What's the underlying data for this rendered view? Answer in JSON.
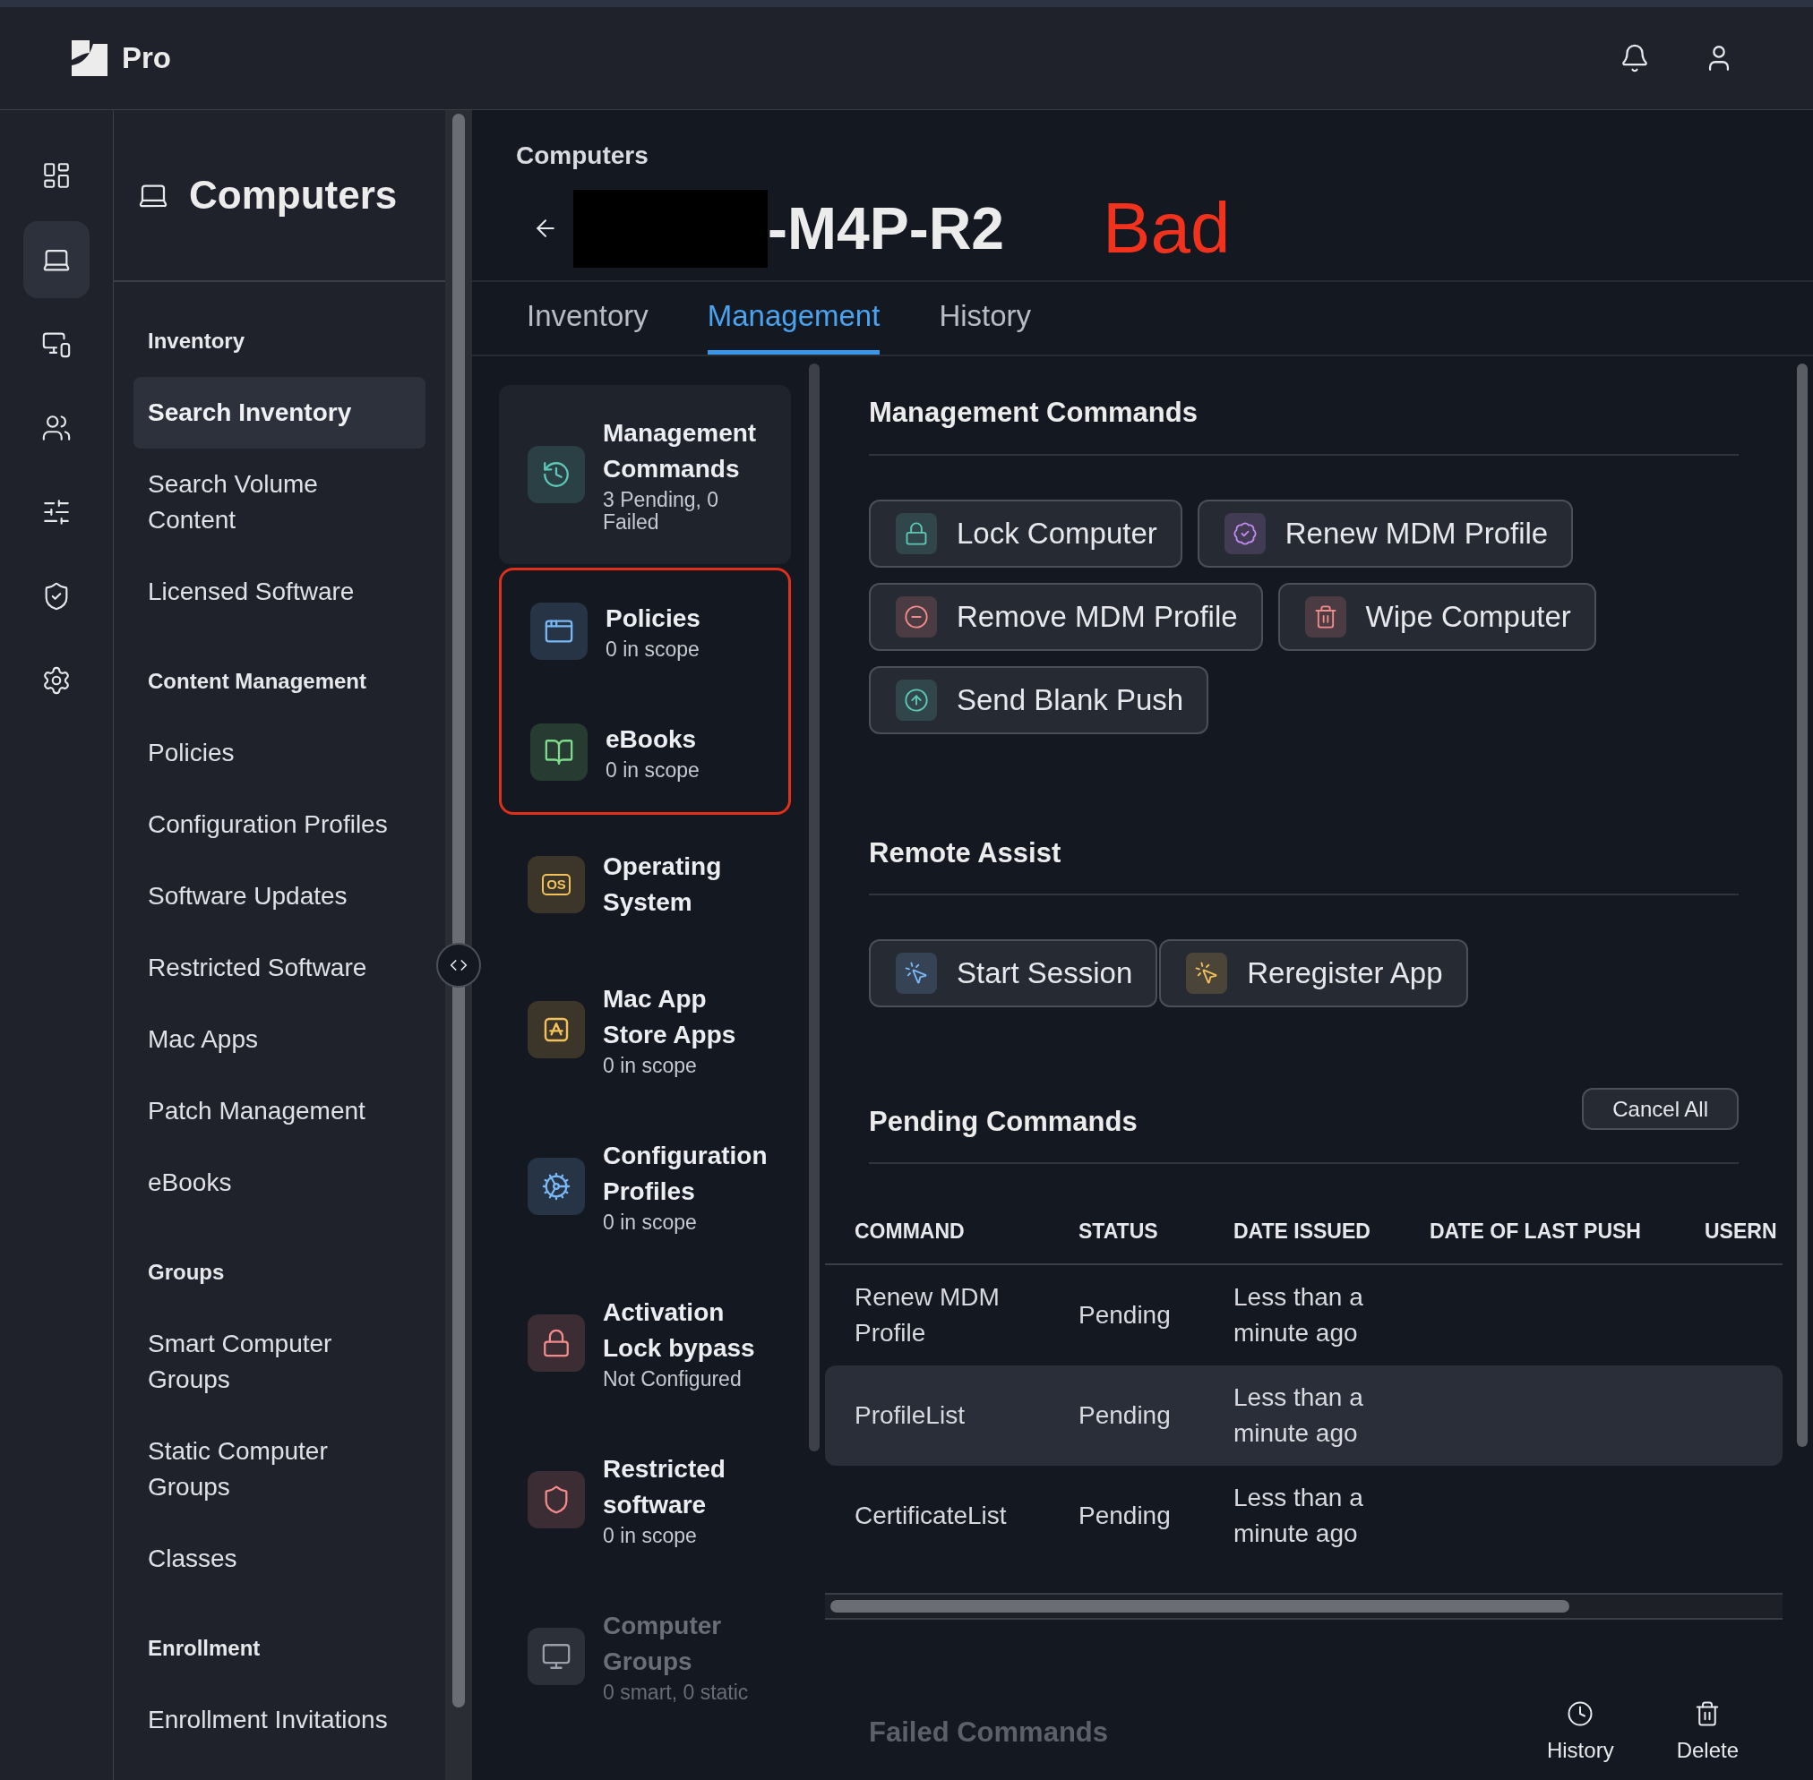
{
  "app": {
    "name": "Pro"
  },
  "rail": [
    {
      "kind": "dashboard",
      "selected": false
    },
    {
      "kind": "laptop",
      "selected": true
    },
    {
      "kind": "devices",
      "selected": false
    },
    {
      "kind": "users",
      "selected": false
    },
    {
      "kind": "sliders",
      "selected": false
    },
    {
      "kind": "shield",
      "selected": false
    },
    {
      "kind": "settings",
      "selected": false
    }
  ],
  "nav": {
    "title": "Computers",
    "sections": [
      {
        "heading": "Inventory",
        "items": [
          {
            "label": "Search Inventory",
            "selected": true
          },
          {
            "label": "Search Volume Content",
            "selected": false
          },
          {
            "label": "Licensed Software",
            "selected": false
          }
        ]
      },
      {
        "heading": "Content Management",
        "items": [
          {
            "label": "Policies",
            "selected": false
          },
          {
            "label": "Configuration Profiles",
            "selected": false
          },
          {
            "label": "Software Updates",
            "selected": false
          },
          {
            "label": "Restricted Software",
            "selected": false
          },
          {
            "label": "Mac Apps",
            "selected": false
          },
          {
            "label": "Patch Management",
            "selected": false
          },
          {
            "label": "eBooks",
            "selected": false
          }
        ]
      },
      {
        "heading": "Groups",
        "items": [
          {
            "label": "Smart Computer Groups",
            "selected": false
          },
          {
            "label": "Static Computer Groups",
            "selected": false
          },
          {
            "label": "Classes",
            "selected": false
          }
        ]
      },
      {
        "heading": "Enrollment",
        "items": [
          {
            "label": "Enrollment Invitations",
            "selected": false
          }
        ]
      }
    ]
  },
  "header": {
    "breadcrumb": "Computers",
    "title": "-M4P-R2",
    "annotation": "Bad"
  },
  "tabs": [
    {
      "label": "Inventory",
      "selected": false
    },
    {
      "label": "Management",
      "selected": true
    },
    {
      "label": "History",
      "selected": false
    }
  ],
  "categories": [
    {
      "kind": "history",
      "color": "#5ec8b8",
      "title": "Management Commands",
      "subtitle": "3 Pending, 0 Failed",
      "selected": true,
      "highlighted": false,
      "faded": false
    },
    {
      "kind": "window",
      "color": "#7ab8f5",
      "title": "Policies",
      "subtitle": "0 in scope",
      "selected": false,
      "highlighted": true,
      "faded": false
    },
    {
      "kind": "book",
      "color": "#7fdc8c",
      "title": "eBooks",
      "subtitle": "0 in scope",
      "selected": false,
      "highlighted": true,
      "faded": false
    },
    {
      "kind": "os",
      "badge": "OS",
      "color": "#f2c15a",
      "title": "Operating System",
      "selected": false,
      "highlighted": false,
      "faded": false
    },
    {
      "kind": "appstore",
      "color": "#f2c15a",
      "title": "Mac App Store Apps",
      "subtitle": "0 in scope",
      "selected": false,
      "highlighted": false,
      "faded": false
    },
    {
      "kind": "cogs",
      "color": "#7ab8f5",
      "title": "Configuration Profiles",
      "subtitle": "0 in scope",
      "selected": false,
      "highlighted": false,
      "faded": false
    },
    {
      "kind": "lock",
      "color": "#f28b8b",
      "title": "Activation Lock bypass",
      "subtitle": "Not Configured",
      "selected": false,
      "highlighted": false,
      "faded": false
    },
    {
      "kind": "shield",
      "color": "#f28b8b",
      "title": "Restricted software",
      "subtitle": "0 in scope",
      "selected": false,
      "highlighted": false,
      "faded": false
    },
    {
      "kind": "monitor",
      "color": "#9aa0aa",
      "title": "Computer Groups",
      "subtitle": "0 smart, 0 static",
      "selected": false,
      "highlighted": false,
      "faded": true
    }
  ],
  "management_commands": {
    "title": "Management Commands",
    "buttons": [
      {
        "kind": "lock",
        "color": "#5ec8b8",
        "label": "Lock Computer"
      },
      {
        "kind": "badge",
        "color": "#c38af0",
        "label": "Renew MDM Profile"
      },
      {
        "kind": "minus",
        "color": "#f28b8b",
        "label": "Remove MDM Profile"
      },
      {
        "kind": "trash",
        "color": "#f28b8b",
        "label": "Wipe Computer"
      },
      {
        "kind": "arrowup",
        "color": "#5ec8b8",
        "label": "Send Blank Push"
      }
    ]
  },
  "remote_assist": {
    "title": "Remote Assist",
    "buttons": [
      {
        "kind": "pointer",
        "color": "#7ab8f5",
        "label": "Start Session"
      },
      {
        "kind": "pointer",
        "color": "#f2c15a",
        "label": "Reregister App"
      }
    ]
  },
  "pending": {
    "title": "Pending Commands",
    "cancel": "Cancel All",
    "columns": [
      "COMMAND",
      "STATUS",
      "DATE ISSUED",
      "DATE OF LAST PUSH",
      "USERN"
    ],
    "rows": [
      {
        "cells": [
          "Renew MDM Profile",
          "Pending",
          "Less than a minute ago"
        ],
        "selected": false
      },
      {
        "cells": [
          "ProfileList",
          "Pending",
          "Less than a minute ago"
        ],
        "selected": true
      },
      {
        "cells": [
          "CertificateList",
          "Pending",
          "Less than a minute ago"
        ],
        "selected": false
      }
    ]
  },
  "failed": {
    "title": "Failed Commands",
    "faded": true
  },
  "actions": [
    {
      "kind": "history",
      "label": "History"
    },
    {
      "kind": "trash",
      "label": "Delete"
    }
  ]
}
